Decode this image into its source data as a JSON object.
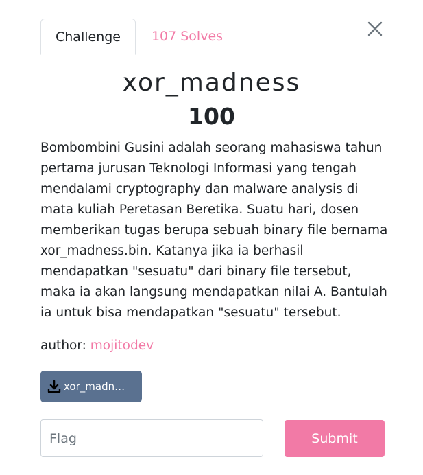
{
  "tabs": {
    "challenge_label": "Challenge",
    "solves_label": "107 Solves"
  },
  "challenge": {
    "name": "xor_madness",
    "value": "100",
    "description": "Bombombini Gusini adalah seorang mahasiswa tahun pertama jurusan Teknologi Informasi yang tengah mendalami cryptography dan malware analysis di mata kuliah Peretasan Beretika. Suatu hari, dosen memberikan tugas berupa sebuah binary file bernama xor_madness.bin. Katanya jika ia berhasil mendapatkan \"sesuatu\" dari binary file tersebut, maka ia akan langsung mendapatkan nilai A. Bantulah ia untuk bisa mendapatkan \"sesuatu\" tersebut.",
    "author_prefix": "author: ",
    "author_name": "mojitodev"
  },
  "download": {
    "file_label": "xor_madn…",
    "icon": "download-icon"
  },
  "form": {
    "flag_placeholder": "Flag",
    "flag_value": "",
    "submit_label": "Submit"
  },
  "icons": {
    "close": "close-icon"
  },
  "colors": {
    "accent": "#f27aa6",
    "download_bg": "#5a7190",
    "text": "#212529",
    "close_icon": "#6c757d"
  }
}
